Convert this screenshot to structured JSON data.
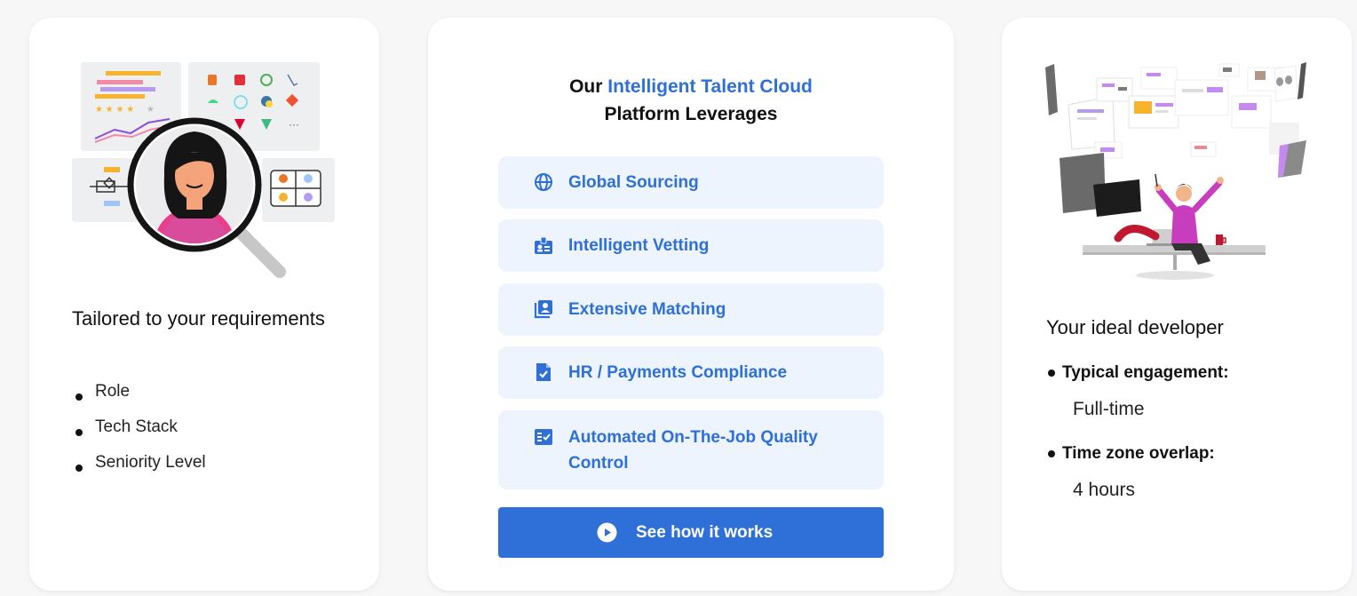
{
  "left_card": {
    "title": "Tailored to your requirements",
    "items": [
      "Role",
      "Tech Stack",
      "Seniority Level"
    ]
  },
  "center_card": {
    "heading_prefix": "Our",
    "heading_accent": "Intelligent Talent Cloud",
    "heading_suffix": "Platform Leverages",
    "features": [
      {
        "label": "Global Sourcing",
        "icon": "globe-icon"
      },
      {
        "label": "Intelligent Vetting",
        "icon": "id-badge-icon"
      },
      {
        "label": "Extensive Matching",
        "icon": "profile-cards-icon"
      },
      {
        "label": "HR / Payments Compliance",
        "icon": "document-check-icon"
      },
      {
        "label": "Automated On-The-Job Quality Control",
        "icon": "checklist-icon"
      }
    ],
    "cta_label": "See how it works",
    "cta_icon": "play-circle-icon"
  },
  "right_card": {
    "title": "Your ideal developer",
    "details": [
      {
        "label": "Typical engagement:",
        "value": "Full-time"
      },
      {
        "label": "Time zone overlap:",
        "value": "4 hours"
      }
    ]
  },
  "colors": {
    "accent": "#2e6fd8",
    "feature_bg": "#edf4fd",
    "page_bg": "#f7f7f8",
    "card_bg": "#ffffff"
  }
}
